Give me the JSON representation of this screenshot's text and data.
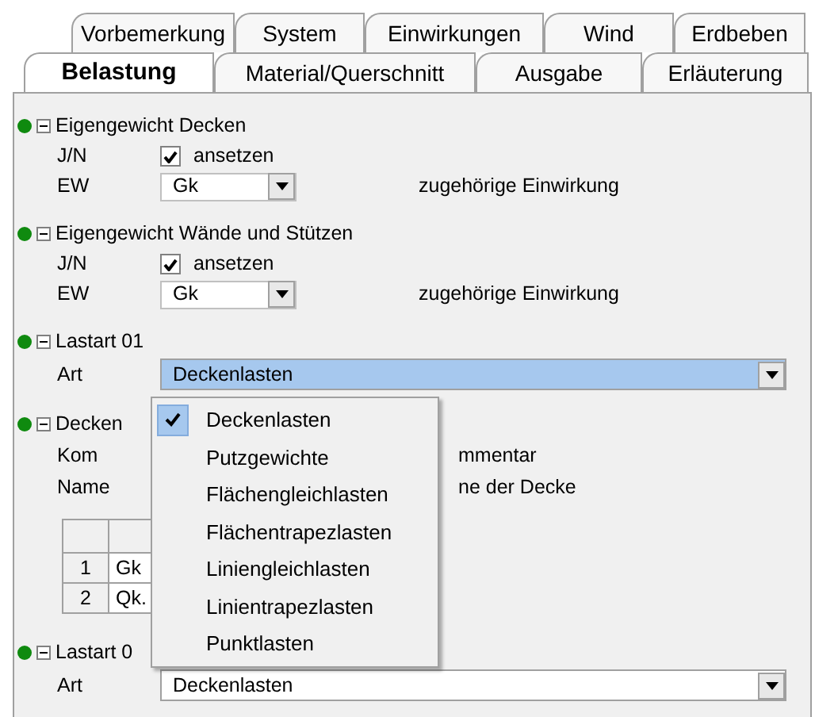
{
  "tabs_row_1": [
    {
      "label": "Vorbemerkung",
      "selected": false
    },
    {
      "label": "System",
      "selected": false
    },
    {
      "label": "Einwirkungen",
      "selected": false
    },
    {
      "label": "Wind",
      "selected": false
    },
    {
      "label": "Erdbeben",
      "selected": false
    }
  ],
  "tabs_row_2": [
    {
      "label": "Belastung",
      "selected": true
    },
    {
      "label": "Material/Querschnitt",
      "selected": false
    },
    {
      "label": "Ausgabe",
      "selected": false
    },
    {
      "label": "Erläuterung",
      "selected": false
    }
  ],
  "sections": [
    {
      "title": "Eigengewicht Decken",
      "color": "#0f8a0f",
      "expanded": true,
      "fields": [
        {
          "kind": "checkbox",
          "label": "J/N",
          "checked": true,
          "text": "ansetzen"
        },
        {
          "kind": "combo",
          "label": "EW",
          "value": "Gk",
          "note": "zugehörige Einwirkung"
        }
      ]
    },
    {
      "title": "Eigengewicht Wände und Stützen",
      "color": "#0f8a0f",
      "expanded": true,
      "fields": [
        {
          "kind": "checkbox",
          "label": "J/N",
          "checked": true,
          "text": "ansetzen"
        },
        {
          "kind": "combo",
          "label": "EW",
          "value": "Gk",
          "note": "zugehörige Einwirkung"
        }
      ]
    },
    {
      "title": "Lastart 01",
      "color": "#0f8a0f",
      "expanded": true,
      "fields": [
        {
          "kind": "wide_combo",
          "label": "Art",
          "value": "Deckenlasten",
          "selected": true
        }
      ]
    },
    {
      "title": "Decken",
      "color": "#0f8a0f",
      "expanded": true,
      "fields": [
        {
          "kind": "text",
          "label": "Kom",
          "note": "mmentar"
        },
        {
          "kind": "text",
          "label": "Name",
          "note": "ne der Decke"
        },
        {
          "kind": "table",
          "rows": [
            {
              "index": "1",
              "cell": "Gk"
            },
            {
              "index": "2",
              "cell": "Qk."
            }
          ]
        }
      ]
    },
    {
      "title": "Lastart 0",
      "color": "#0f8a0f",
      "expanded": true,
      "fields": [
        {
          "kind": "wide_combo",
          "label": "Art",
          "value": "Deckenlasten",
          "selected": false
        }
      ]
    }
  ],
  "dropdown": {
    "items": [
      {
        "label": "Deckenlasten",
        "selected": true
      },
      {
        "label": "Putzgewichte",
        "selected": false
      },
      {
        "label": "Flächengleichlasten",
        "selected": false
      },
      {
        "label": "Flächentrapezlasten",
        "selected": false
      },
      {
        "label": "Liniengleichlasten",
        "selected": false
      },
      {
        "label": "Linientrapezlasten",
        "selected": false
      },
      {
        "label": "Punktlasten",
        "selected": false
      }
    ]
  }
}
